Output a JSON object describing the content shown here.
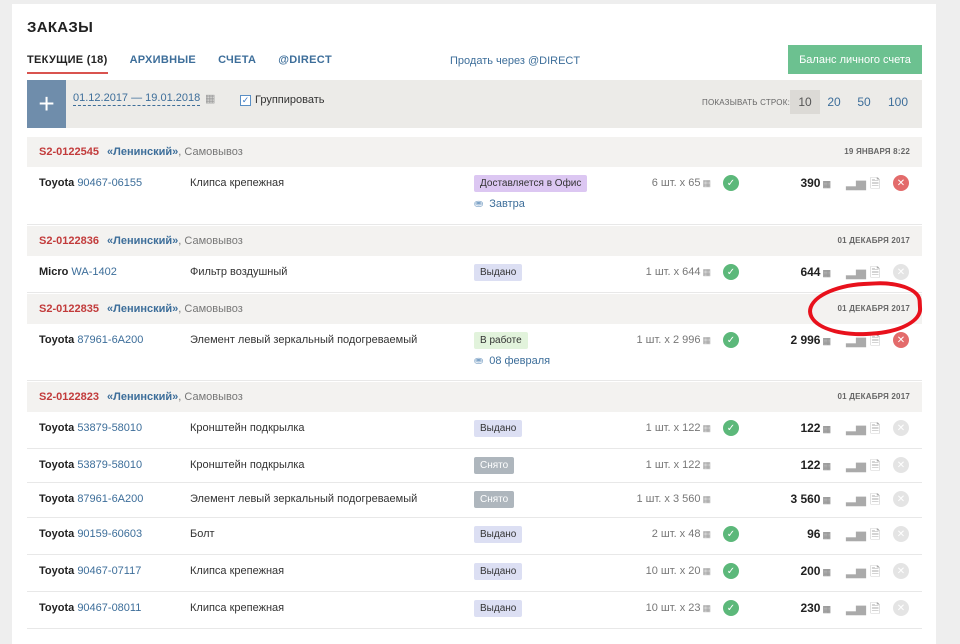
{
  "page": {
    "title": "ЗАКАЗЫ"
  },
  "tabs": [
    {
      "label": "ТЕКУЩИЕ (18)",
      "active": true
    },
    {
      "label": "АРХИВНЫЕ"
    },
    {
      "label": "СЧЕТА"
    },
    {
      "label": "@DIRECT"
    }
  ],
  "sell_link": "Продать через @DIRECT",
  "balance_button": "Баланс личного счета",
  "toolbar": {
    "date_range": "01.12.2017 — 19.01.2018",
    "group_label": "Группировать",
    "group_checked": true,
    "rows_label": "ПОКАЗЫВАТЬ СТРОК:",
    "rows_options": [
      "10",
      "20",
      "50",
      "100"
    ],
    "rows_selected": "10"
  },
  "groups": [
    {
      "order_id": "S2-0122545",
      "warehouse": "«Ленинский»",
      "delivery": ", Самовывоз",
      "date": "19 ЯНВАРЯ 8:22",
      "items": [
        {
          "brand": "Toyota",
          "code": "90467-06155",
          "name": "Клипса крепежная",
          "status": "Доставляется в Офис",
          "status_style": "purple",
          "delivery_date": "Завтра",
          "qty": "6 шт. x 65",
          "check": true,
          "sum": "390",
          "cancel_active": true
        }
      ]
    },
    {
      "order_id": "S2-0122836",
      "warehouse": "«Ленинский»",
      "delivery": ", Самовывоз",
      "date": "01 ДЕКАБРЯ 2017",
      "items": [
        {
          "brand": "Micro",
          "code": "WA-1402",
          "name": "Фильтр воздушный",
          "status": "Выдано",
          "status_style": "blue",
          "qty": "1 шт. x 644",
          "check": true,
          "sum": "644",
          "cancel_active": false
        }
      ]
    },
    {
      "order_id": "S2-0122835",
      "warehouse": "«Ленинский»",
      "delivery": ", Самовывоз",
      "date": "01 ДЕКАБРЯ 2017",
      "items": [
        {
          "brand": "Toyota",
          "code": "87961-6A200",
          "name": "Элемент левый зеркальный подогреваемый",
          "status": "В работе",
          "status_style": "green",
          "delivery_date": "08 февраля",
          "qty": "1 шт. x 2 996",
          "check": true,
          "sum": "2 996",
          "cancel_active": true
        }
      ]
    },
    {
      "order_id": "S2-0122823",
      "warehouse": "«Ленинский»",
      "delivery": ", Самовывоз",
      "date": "01 ДЕКАБРЯ 2017",
      "items": [
        {
          "brand": "Toyota",
          "code": "53879-58010",
          "name": "Кронштейн подкрылка",
          "status": "Выдано",
          "status_style": "blue",
          "qty": "1 шт. x 122",
          "check": true,
          "sum": "122",
          "cancel_active": false
        },
        {
          "brand": "Toyota",
          "code": "53879-58010",
          "name": "Кронштейн подкрылка",
          "status": "Снято",
          "status_style": "gray",
          "qty": "1 шт. x 122",
          "check": false,
          "sum": "122",
          "cancel_active": false
        },
        {
          "brand": "Toyota",
          "code": "87961-6A200",
          "name": "Элемент левый зеркальный подогреваемый",
          "status": "Снято",
          "status_style": "gray",
          "qty": "1 шт. x 3 560",
          "check": false,
          "sum": "3 560",
          "cancel_active": false
        },
        {
          "brand": "Toyota",
          "code": "90159-60603",
          "name": "Болт",
          "status": "Выдано",
          "status_style": "blue",
          "qty": "2 шт. x 48",
          "check": true,
          "sum": "96",
          "cancel_active": false
        },
        {
          "brand": "Toyota",
          "code": "90467-07117",
          "name": "Клипса крепежная",
          "status": "Выдано",
          "status_style": "blue",
          "qty": "10 шт. x 20",
          "check": true,
          "sum": "200",
          "cancel_active": false
        },
        {
          "brand": "Toyota",
          "code": "90467-08011",
          "name": "Клипса крепежная",
          "status": "Выдано",
          "status_style": "blue",
          "qty": "10 шт. x 23",
          "check": true,
          "sum": "230",
          "cancel_active": false
        }
      ]
    }
  ],
  "colors": {
    "accent": "#3d6e9a",
    "order_id": "#c23b3b",
    "balance": "#6cc190",
    "check": "#5cb87a",
    "cancel": "#e36b6b"
  },
  "icons": {
    "add": "plus-icon",
    "calendar": "calendar-icon",
    "truck": "truck-icon",
    "check": "check-icon",
    "stats": "bar-chart-icon",
    "doc": "document-add-icon",
    "cancel": "cancel-icon"
  }
}
